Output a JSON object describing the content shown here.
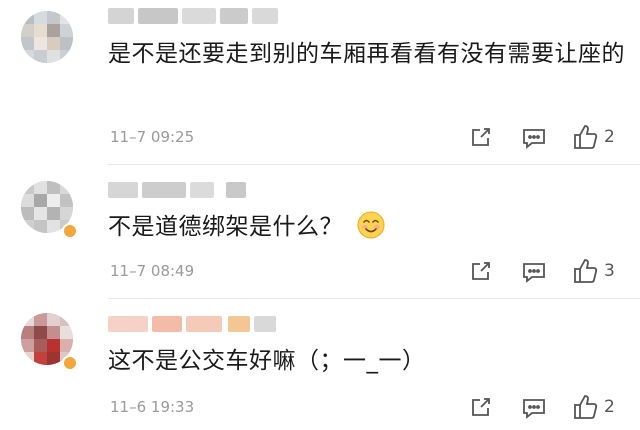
{
  "comments": [
    {
      "text": "是不是还要走到别的车厢再看看有没有需要让座的",
      "time": "11–7 09:25",
      "likes": "2"
    },
    {
      "text": "不是道德绑架是什么？",
      "emoji": "smiling-face-emoji",
      "time": "11–7 08:49",
      "likes": "3"
    },
    {
      "text": "这不是公交车好嘛（；一_一）",
      "time": "11–6 19:33",
      "likes": "2"
    }
  ],
  "icons": {
    "share": "share-icon",
    "reply": "reply-icon",
    "like": "thumbs-up-icon"
  },
  "colors": {
    "timestamp": "#9a9a9a",
    "icon": "#555555",
    "divider": "#e8e8e8"
  }
}
